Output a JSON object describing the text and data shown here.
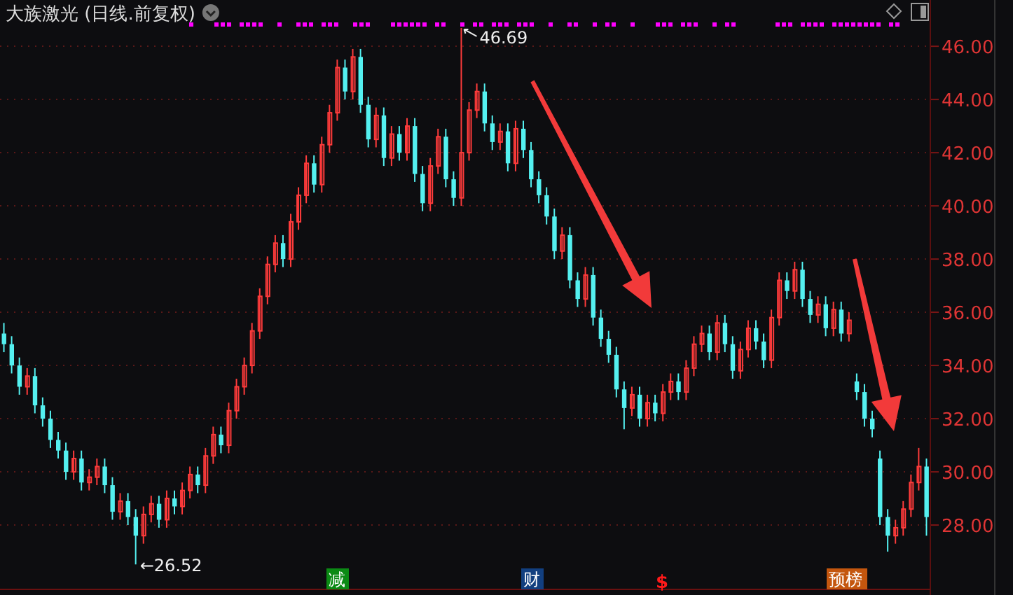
{
  "title": "大族激光 (日线.前复权)",
  "chart_data": {
    "type": "candlestick",
    "categories": [
      null,
      null,
      null,
      null,
      null,
      null,
      null,
      null,
      null,
      null,
      null,
      null,
      null,
      null,
      null,
      null,
      null,
      null,
      null,
      null,
      null,
      null,
      null,
      null,
      null,
      null,
      null,
      null,
      null,
      null,
      null,
      null,
      null,
      null,
      null,
      null,
      null,
      null,
      null,
      null,
      null,
      null,
      null,
      null,
      null,
      null,
      null,
      null,
      null,
      null,
      null,
      null,
      null,
      null,
      null,
      null,
      null,
      null,
      null,
      null,
      null,
      null,
      null,
      null,
      null,
      null,
      null,
      null,
      null,
      null,
      null,
      null,
      null,
      null,
      null,
      null,
      null,
      null,
      null,
      null,
      null,
      null,
      null,
      null,
      null,
      null,
      null,
      null,
      null,
      null,
      null,
      null,
      null,
      null,
      null,
      null,
      null,
      null,
      null,
      null,
      null,
      null,
      null,
      null,
      null,
      null,
      null,
      null,
      null,
      null,
      null,
      null,
      null,
      null,
      null,
      null,
      null,
      null,
      null,
      null
    ],
    "ohlc": [
      [
        35.2,
        35.6,
        34.5,
        34.8
      ],
      [
        34.8,
        35.1,
        33.7,
        34.0
      ],
      [
        34.0,
        34.3,
        32.9,
        33.2
      ],
      [
        33.2,
        33.9,
        32.9,
        33.6
      ],
      [
        33.6,
        33.9,
        32.2,
        32.5
      ],
      [
        32.5,
        32.8,
        31.7,
        32.0
      ],
      [
        32.0,
        32.3,
        30.9,
        31.2
      ],
      [
        31.2,
        31.5,
        30.5,
        30.8
      ],
      [
        30.8,
        31.1,
        29.7,
        30.0
      ],
      [
        30.0,
        30.8,
        29.7,
        30.5
      ],
      [
        30.5,
        30.8,
        29.3,
        29.6
      ],
      [
        29.6,
        30.1,
        29.3,
        29.8
      ],
      [
        29.8,
        30.5,
        29.5,
        30.2
      ],
      [
        30.2,
        30.5,
        29.2,
        29.5
      ],
      [
        29.5,
        29.8,
        28.2,
        28.5
      ],
      [
        28.5,
        29.2,
        28.2,
        28.9
      ],
      [
        28.9,
        29.2,
        28.0,
        28.3
      ],
      [
        28.3,
        28.6,
        26.52,
        27.6
      ],
      [
        27.6,
        28.7,
        27.3,
        28.4
      ],
      [
        28.4,
        29.1,
        28.1,
        28.8
      ],
      [
        28.8,
        29.1,
        27.9,
        28.2
      ],
      [
        28.2,
        29.3,
        27.9,
        29.0
      ],
      [
        29.0,
        29.3,
        28.4,
        28.7
      ],
      [
        28.7,
        29.6,
        28.4,
        29.3
      ],
      [
        29.3,
        30.2,
        29.0,
        29.9
      ],
      [
        29.9,
        30.2,
        29.2,
        29.5
      ],
      [
        29.5,
        30.9,
        29.2,
        30.6
      ],
      [
        30.6,
        31.7,
        30.3,
        31.4
      ],
      [
        31.4,
        31.7,
        30.7,
        31.0
      ],
      [
        31.0,
        32.6,
        30.7,
        32.3
      ],
      [
        32.3,
        33.5,
        32.0,
        33.2
      ],
      [
        33.2,
        34.3,
        32.9,
        34.0
      ],
      [
        34.0,
        35.6,
        33.7,
        35.3
      ],
      [
        35.3,
        36.9,
        35.0,
        36.6
      ],
      [
        36.6,
        38.1,
        36.3,
        37.8
      ],
      [
        37.8,
        38.9,
        37.5,
        38.6
      ],
      [
        38.6,
        38.9,
        37.7,
        38.0
      ],
      [
        38.0,
        39.7,
        37.7,
        39.4
      ],
      [
        39.4,
        40.7,
        39.1,
        40.4
      ],
      [
        40.4,
        41.9,
        40.1,
        41.6
      ],
      [
        41.6,
        41.9,
        40.5,
        40.8
      ],
      [
        40.8,
        42.6,
        40.5,
        42.3
      ],
      [
        42.3,
        43.8,
        42.0,
        43.5
      ],
      [
        43.5,
        45.5,
        43.2,
        45.2
      ],
      [
        45.2,
        45.5,
        44.0,
        44.3
      ],
      [
        44.3,
        45.9,
        44.0,
        45.6
      ],
      [
        45.6,
        45.9,
        43.5,
        43.8
      ],
      [
        43.8,
        44.1,
        42.2,
        42.5
      ],
      [
        42.5,
        43.7,
        42.2,
        43.4
      ],
      [
        43.4,
        43.7,
        41.5,
        41.8
      ],
      [
        41.8,
        43.0,
        41.5,
        42.7
      ],
      [
        42.7,
        43.0,
        41.7,
        42.0
      ],
      [
        42.0,
        43.3,
        41.7,
        43.0
      ],
      [
        43.0,
        43.3,
        40.9,
        41.2
      ],
      [
        41.2,
        41.5,
        39.8,
        40.1
      ],
      [
        40.1,
        41.8,
        39.8,
        41.5
      ],
      [
        41.5,
        42.9,
        41.2,
        42.6
      ],
      [
        42.6,
        42.9,
        40.7,
        41.0
      ],
      [
        41.0,
        41.3,
        40.0,
        40.3
      ],
      [
        40.3,
        46.69,
        40.0,
        42.0
      ],
      [
        42.0,
        43.9,
        41.7,
        43.6
      ],
      [
        43.6,
        44.6,
        43.3,
        44.3
      ],
      [
        44.3,
        44.6,
        42.8,
        43.1
      ],
      [
        43.1,
        43.4,
        42.1,
        42.4
      ],
      [
        42.4,
        43.1,
        42.1,
        42.8
      ],
      [
        42.8,
        43.1,
        41.3,
        41.6
      ],
      [
        41.6,
        43.2,
        41.3,
        42.9
      ],
      [
        42.9,
        43.2,
        41.8,
        42.1
      ],
      [
        42.1,
        42.4,
        40.7,
        41.0
      ],
      [
        41.0,
        41.3,
        40.1,
        40.4
      ],
      [
        40.4,
        40.7,
        39.3,
        39.6
      ],
      [
        39.6,
        39.9,
        38.0,
        38.3
      ],
      [
        38.3,
        39.2,
        38.0,
        38.9
      ],
      [
        38.9,
        39.2,
        36.9,
        37.2
      ],
      [
        37.2,
        37.5,
        36.2,
        36.5
      ],
      [
        36.5,
        37.7,
        36.2,
        37.4
      ],
      [
        37.4,
        37.7,
        35.5,
        35.8
      ],
      [
        35.8,
        36.1,
        34.7,
        35.0
      ],
      [
        35.0,
        35.3,
        34.1,
        34.4
      ],
      [
        34.4,
        34.7,
        32.8,
        33.1
      ],
      [
        33.1,
        33.4,
        31.6,
        32.4
      ],
      [
        32.4,
        33.2,
        32.1,
        32.9
      ],
      [
        32.9,
        33.2,
        31.7,
        32.0
      ],
      [
        32.0,
        32.9,
        31.7,
        32.6
      ],
      [
        32.6,
        32.9,
        31.9,
        32.2
      ],
      [
        32.2,
        33.3,
        31.9,
        33.0
      ],
      [
        33.0,
        33.7,
        32.7,
        33.4
      ],
      [
        33.4,
        33.7,
        32.7,
        33.0
      ],
      [
        33.0,
        34.2,
        32.7,
        33.9
      ],
      [
        33.9,
        35.1,
        33.6,
        34.8
      ],
      [
        34.8,
        35.5,
        34.5,
        35.2
      ],
      [
        35.2,
        35.5,
        34.2,
        34.5
      ],
      [
        34.5,
        35.9,
        34.2,
        35.6
      ],
      [
        35.6,
        35.9,
        34.5,
        34.8
      ],
      [
        34.8,
        35.1,
        33.5,
        33.8
      ],
      [
        33.8,
        34.9,
        33.5,
        34.6
      ],
      [
        34.6,
        35.7,
        34.3,
        35.4
      ],
      [
        35.4,
        35.7,
        34.6,
        34.9
      ],
      [
        34.9,
        35.2,
        33.9,
        34.2
      ],
      [
        34.2,
        36.1,
        33.9,
        35.8
      ],
      [
        35.8,
        37.5,
        35.5,
        37.2
      ],
      [
        37.2,
        37.5,
        36.5,
        36.8
      ],
      [
        36.8,
        37.9,
        36.5,
        37.6
      ],
      [
        37.6,
        37.9,
        36.2,
        36.5
      ],
      [
        36.5,
        36.8,
        35.6,
        35.9
      ],
      [
        35.9,
        36.6,
        35.6,
        36.3
      ],
      [
        36.3,
        36.6,
        35.1,
        35.4
      ],
      [
        35.4,
        36.4,
        35.1,
        36.1
      ],
      [
        36.1,
        36.4,
        34.9,
        35.2
      ],
      [
        35.2,
        36.0,
        34.9,
        35.7
      ],
      [
        33.4,
        33.7,
        32.7,
        33.0
      ],
      [
        33.0,
        33.3,
        31.7,
        32.0
      ],
      [
        32.0,
        32.3,
        31.3,
        31.6
      ],
      [
        30.5,
        30.8,
        28.0,
        28.3
      ],
      [
        28.3,
        28.6,
        27.0,
        27.6
      ],
      [
        27.6,
        28.2,
        27.3,
        27.9
      ],
      [
        27.9,
        28.9,
        27.6,
        28.6
      ],
      [
        28.6,
        29.9,
        28.3,
        29.6
      ],
      [
        29.6,
        30.9,
        29.3,
        30.2
      ],
      [
        30.2,
        30.5,
        27.6,
        28.3
      ]
    ],
    "yticks": [
      {
        "value": 46,
        "label": "46.00"
      },
      {
        "value": 44,
        "label": "44.00"
      },
      {
        "value": 42,
        "label": "42.00"
      },
      {
        "value": 40,
        "label": "40.00"
      },
      {
        "value": 38,
        "label": "38.00"
      },
      {
        "value": 36,
        "label": "36.00"
      },
      {
        "value": 34,
        "label": "34.00"
      },
      {
        "value": 32,
        "label": "32.00"
      },
      {
        "value": 30,
        "label": "30.00"
      },
      {
        "value": 28,
        "label": "28.00"
      }
    ],
    "ylim": [
      25.37,
      47.74
    ],
    "grid": true,
    "annotations": [
      "46.69",
      "←26.52"
    ]
  },
  "event_tags": [
    {
      "kind": "tag",
      "text": "减",
      "color": "#0b8a14"
    },
    {
      "kind": "tag",
      "text": "财",
      "color": "#123f80"
    },
    {
      "kind": "symbol",
      "text": "$",
      "color": "#ff1a1a"
    },
    {
      "kind": "tag",
      "text": "预榜",
      "color": "#c4560e"
    }
  ]
}
